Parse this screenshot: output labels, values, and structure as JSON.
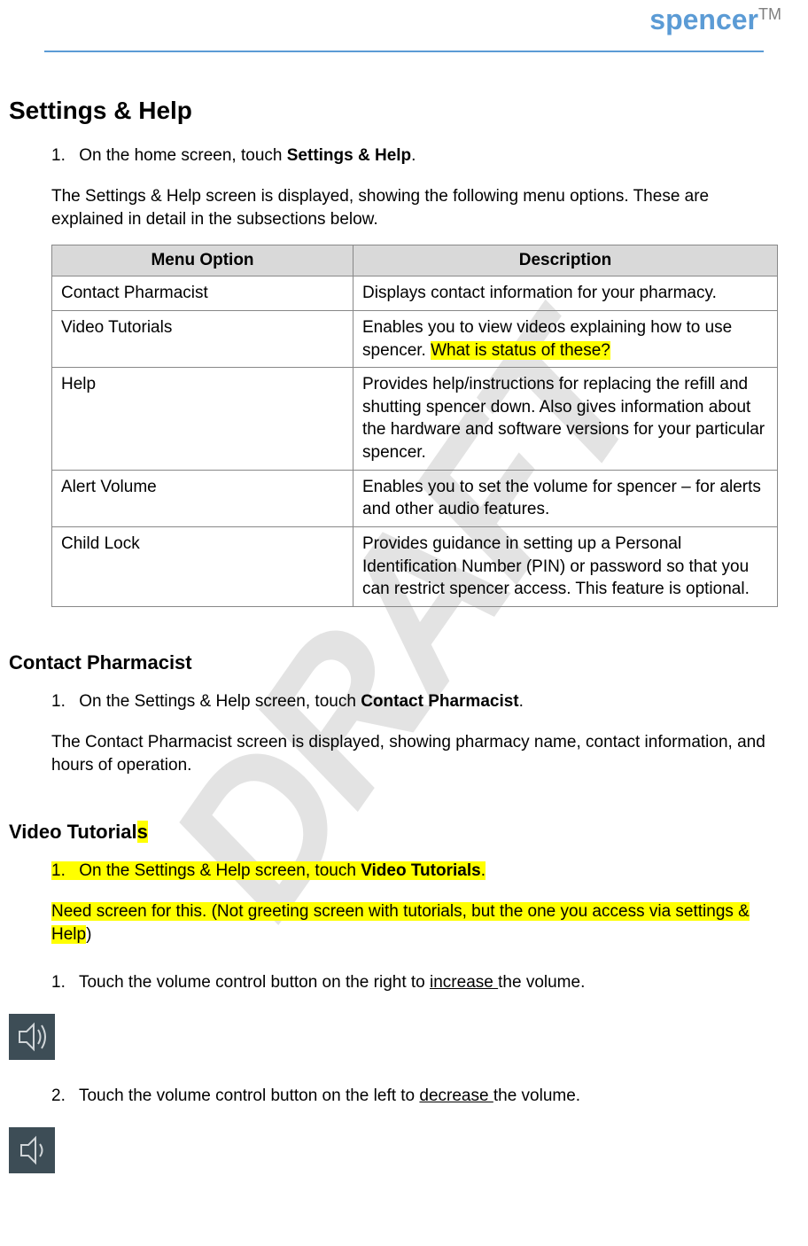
{
  "brand": {
    "name": "spencer",
    "tm": "TM"
  },
  "watermark": "DRAFT",
  "title": "Settings & Help",
  "intro_step": {
    "num": "1.",
    "prefix": "On the home screen, touch ",
    "bold": "Settings & Help",
    "suffix": "."
  },
  "intro_para": "The Settings & Help screen is displayed, showing the following menu options. These are explained in detail in the subsections below.",
  "table": {
    "header_menu": "Menu Option",
    "header_desc": "Description",
    "rows": [
      {
        "menu": "Contact Pharmacist",
        "desc": "Displays contact information for your pharmacy.",
        "highlight": ""
      },
      {
        "menu": "Video Tutorials",
        "desc": "Enables you to view videos explaining how to use spencer.  ",
        "highlight": "What is status of these?"
      },
      {
        "menu": "Help",
        "desc": "Provides help/instructions for replacing the refill and shutting spencer down. Also gives information about the hardware and software versions for your particular spencer.",
        "highlight": ""
      },
      {
        "menu": "Alert Volume",
        "desc": "Enables you to set the volume for spencer – for alerts and other audio features.",
        "highlight": ""
      },
      {
        "menu": "Child Lock",
        "desc": "Provides guidance in setting up a Personal Identification Number (PIN) or password so that you can restrict spencer access. This feature is optional.",
        "highlight": ""
      }
    ]
  },
  "section_contact": {
    "title": "Contact Pharmacist",
    "step_num": "1.",
    "step_prefix": "On the Settings & Help screen, touch ",
    "step_bold": "Contact Pharmacist",
    "step_suffix": ".",
    "para": "The Contact Pharmacist screen is displayed, showing pharmacy name, contact information, and hours of operation."
  },
  "section_video": {
    "title_plain": "Video Tutorial",
    "title_hl": "s",
    "step_num": "1.",
    "step_prefix": "On the Settings & Help screen, touch ",
    "step_bold": "Video Tutorials",
    "step_suffix": ".",
    "note": "Need screen for this.  (Not greeting screen with tutorials, but the one you access via settings & Help",
    "note_tail": ")"
  },
  "volume_steps": {
    "s1_num": "1.",
    "s1_prefix": "Touch the volume control button on the right to ",
    "s1_ul": "increase ",
    "s1_suffix": "the volume.",
    "s2_num": "2.",
    "s2_prefix": " Touch the volume control button on the left to ",
    "s2_ul": "decrease ",
    "s2_suffix": "the volume."
  }
}
